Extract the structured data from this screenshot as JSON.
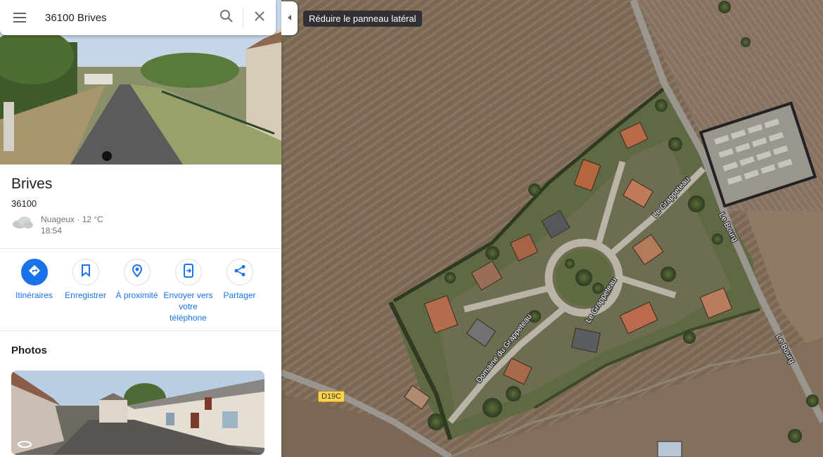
{
  "search": {
    "value": "36100 Brives"
  },
  "place": {
    "title": "Brives",
    "postal_code": "36100",
    "weather": {
      "condition": "Nuageux · 12 °C",
      "time": "18:54"
    }
  },
  "actions": [
    {
      "label": "Itinéraires",
      "icon": "directions-icon"
    },
    {
      "label": "Enregistrer",
      "icon": "bookmark-icon"
    },
    {
      "label": "À proximité",
      "icon": "nearby-icon"
    },
    {
      "label": "Envoyer vers votre téléphone",
      "icon": "send-to-phone-icon"
    },
    {
      "label": "Partager",
      "icon": "share-icon"
    }
  ],
  "photos": {
    "title": "Photos"
  },
  "collapse_tooltip": "Réduire le panneau latéral",
  "map": {
    "route_badge": "D19C",
    "road_labels": [
      "Le Grappeteau",
      "Le Grappeteau",
      "Domaine du Grappeteau",
      "Le Bourg",
      "Le Bourg"
    ]
  },
  "colors": {
    "accent": "#1a73e8",
    "route_badge": "#fcd34d"
  }
}
